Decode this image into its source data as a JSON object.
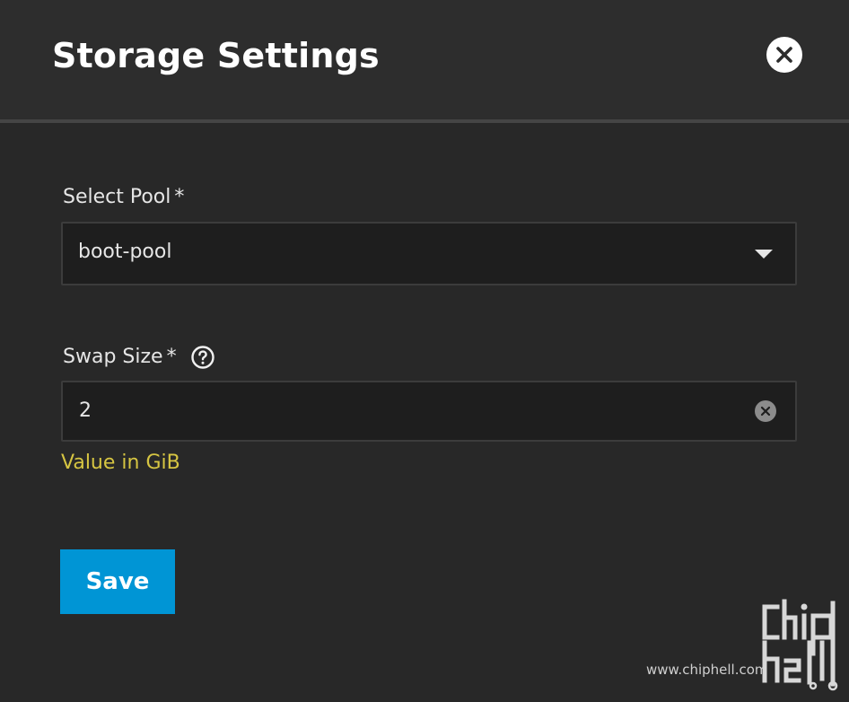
{
  "dialog": {
    "title": "Storage Settings",
    "close_icon": "close-icon"
  },
  "pool_field": {
    "label": "Select Pool",
    "required_marker": "*",
    "value": "boot-pool",
    "arrow_icon": "dropdown-arrow-icon"
  },
  "swap_field": {
    "label": "Swap Size",
    "required_marker": "*",
    "help_icon": "help-circle-icon",
    "value": "2",
    "clear_icon": "clear-icon",
    "hint": "Value in GiB"
  },
  "actions": {
    "save_label": "Save"
  },
  "watermark": {
    "site": "www.chiphell.com",
    "logo_text": "chiphell"
  },
  "colors": {
    "background": "#282828",
    "header_background": "#2d2d2d",
    "field_background": "#1e1e1e",
    "primary": "#0095d5",
    "hint": "#d6c542",
    "text": "#e6e6e6"
  }
}
